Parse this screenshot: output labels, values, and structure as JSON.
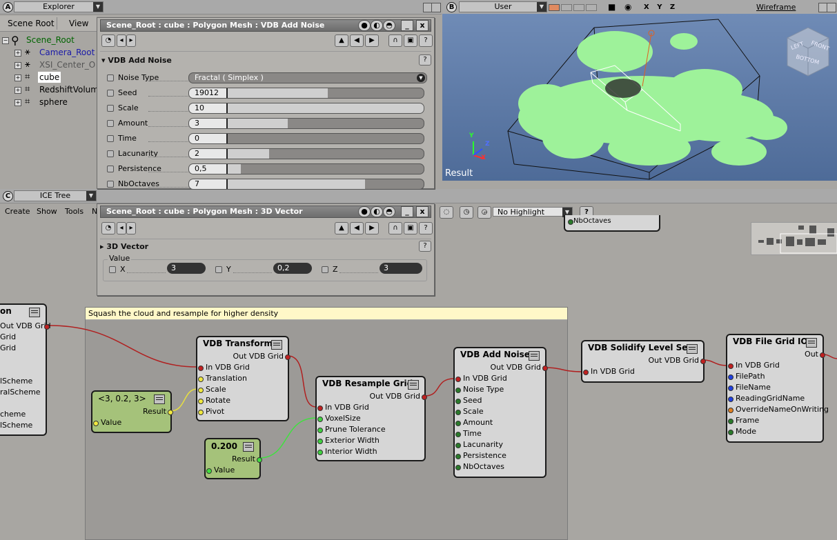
{
  "explorer": {
    "letter": "A",
    "title": "Explorer",
    "scene_root_btn": "Scene Root",
    "view_btn": "View",
    "items": [
      {
        "label": "Scene_Root",
        "color": "#006400"
      },
      {
        "label": "Camera_Root",
        "color": "#1a1aa8"
      },
      {
        "label": "XSI_Center_O",
        "color": "#555555"
      },
      {
        "label": "cube",
        "color": "#000000"
      },
      {
        "label": "RedshiftVolum",
        "color": "#000000"
      },
      {
        "label": "sphere",
        "color": "#000000"
      }
    ]
  },
  "viewport": {
    "letter": "B",
    "camera": "User",
    "axes": "X Y Z",
    "mode": "Wireframe",
    "result_label": "Result",
    "cube_faces": [
      "LEFT",
      "FRONT",
      "BOTTOM"
    ],
    "axis_x": "X",
    "axis_y": "Y",
    "axis_z": "Z"
  },
  "ppg_noise": {
    "title": "Scene_Root : cube : Polygon Mesh : VDB Add Noise",
    "section": "VDB Add Noise",
    "params": [
      {
        "name": "Noise Type",
        "value": "Fractal ( Simplex )",
        "type": "dropdown"
      },
      {
        "name": "Seed",
        "value": "19012",
        "fill": 0.59
      },
      {
        "name": "Scale",
        "value": "10",
        "fill": 1.0
      },
      {
        "name": "Amount",
        "value": "3",
        "fill": 0.42
      },
      {
        "name": "Time",
        "value": "0",
        "fill": 0.16
      },
      {
        "name": "Lacunarity",
        "value": "2",
        "fill": 0.34
      },
      {
        "name": "Persistence",
        "value": "0,5",
        "fill": 0.22
      },
      {
        "name": "NbOctaves",
        "value": "7",
        "fill": 0.75
      }
    ]
  },
  "ice_tree": {
    "letter": "C",
    "title": "ICE Tree",
    "menu": [
      "Create",
      "Show",
      "Tools",
      "N"
    ],
    "highlight": "No Highlight",
    "partial_node_label": "NbOctaves"
  },
  "ppg_vector": {
    "title": "Scene_Root : cube : Polygon Mesh : 3D Vector",
    "section": "3D Vector",
    "group": "Value",
    "x_label": "X",
    "x_value": "3",
    "y_label": "Y",
    "y_value": "0,2",
    "z_label": "Z",
    "z_value": "3"
  },
  "comment": "Squash the cloud and resample for higher density",
  "nodes": {
    "left_partial": {
      "title": "on",
      "ports": [
        "Out VDB Grid",
        "Grid",
        "Grid",
        "lScheme",
        "ralScheme",
        "cheme",
        "lScheme"
      ]
    },
    "vec3": {
      "title": "<3, 0.2, 3>",
      "out": "Result",
      "in": "Value"
    },
    "scalar": {
      "title": "0.200",
      "out": "Result",
      "in": "Value"
    },
    "transform": {
      "title": "VDB Transform",
      "out": "Out VDB Grid",
      "ins": [
        "In VDB Grid",
        "Translation",
        "Scale",
        "Rotate",
        "Pivot"
      ]
    },
    "resample": {
      "title": "VDB Resample Grid",
      "out": "Out VDB Grid",
      "ins": [
        "In VDB Grid",
        "VoxelSize",
        "Prune Tolerance",
        "Exterior Width",
        "Interior Width"
      ]
    },
    "noise": {
      "title": "VDB Add Noise",
      "out": "Out VDB Grid",
      "ins": [
        "In VDB Grid",
        "Noise Type",
        "Seed",
        "Scale",
        "Amount",
        "Time",
        "Lacunarity",
        "Persistence",
        "NbOctaves"
      ]
    },
    "solidify": {
      "title": "VDB Solidify Level Set",
      "out": "Out VDB Grid",
      "ins": [
        "In VDB Grid"
      ]
    },
    "fileio": {
      "title": "VDB File Grid IO",
      "out": "Out",
      "ins": [
        "In VDB Grid",
        "FilePath",
        "FileName",
        "ReadingGridName",
        "OverrideNameOnWriting",
        "Frame",
        "Mode"
      ]
    }
  }
}
